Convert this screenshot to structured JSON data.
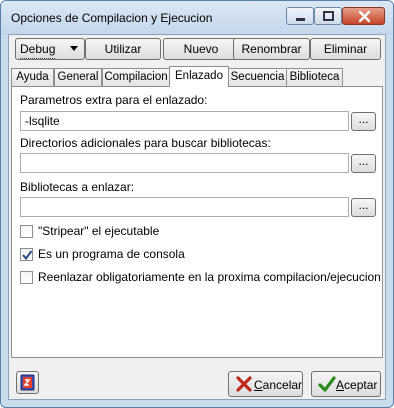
{
  "window": {
    "title": "Opciones de Compilacion y Ejecucion"
  },
  "toolbar": {
    "profile_selected": "Debug",
    "utilizar": "Utilizar",
    "nuevo": "Nuevo",
    "renombrar": "Renombrar",
    "eliminar": "Eliminar"
  },
  "tabs": [
    {
      "label": "Ayuda"
    },
    {
      "label": "General"
    },
    {
      "label": "Compilacion"
    },
    {
      "label": "Enlazado"
    },
    {
      "label": "Secuencia"
    },
    {
      "label": "Biblioteca"
    }
  ],
  "active_tab": "Enlazado",
  "linker": {
    "extra_params_label": "Parametros extra para el enlazado:",
    "extra_params_value": "-lsqlite",
    "lib_dirs_label": "Directorios adicionales para buscar bibliotecas:",
    "lib_dirs_value": "",
    "libs_label": "Bibliotecas a enlazar:",
    "libs_value": "",
    "browse_label": "...",
    "strip_label": "\"Stripear\" el ejecutable",
    "strip_checked": false,
    "console_label": "Es un programa de consola",
    "console_checked": true,
    "relink_label": "Reenlazar obligatoriamente en la proxima compilacion/ejecucion",
    "relink_checked": false
  },
  "footer": {
    "cancel_mnemonic": "C",
    "cancel_rest": "ancelar",
    "accept_mnemonic": "A",
    "accept_rest": "ceptar"
  },
  "colors": {
    "title_bar": "#c9dced",
    "close_button": "#c7442a",
    "check_mark": "#2a4a8a",
    "cancel_icon": "#c0281e",
    "accept_icon": "#2d8a1e"
  }
}
